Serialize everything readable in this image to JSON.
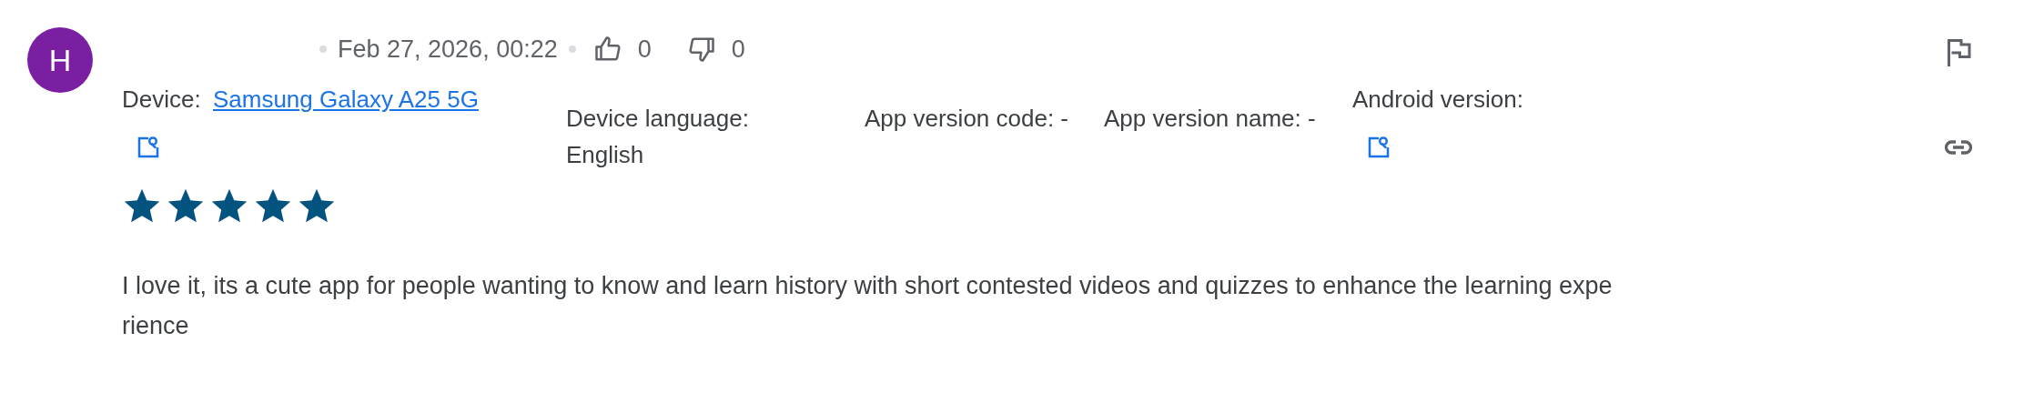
{
  "review": {
    "avatar": {
      "initial": "H",
      "color": "#7b1fa2"
    },
    "date": "Feb 27, 2026, 00:22",
    "likes": "0",
    "dislikes": "0",
    "details": [
      {
        "kind": "link",
        "label": "Device:",
        "value": "Samsung Galaxy A25 5G"
      },
      {
        "kind": "text",
        "label": "Device language:",
        "value": "English"
      },
      {
        "kind": "text",
        "label": "App version code:",
        "value": "-"
      },
      {
        "kind": "text",
        "label": "App version name:",
        "value": "-"
      },
      {
        "kind": "icon",
        "label": "Android version:"
      }
    ],
    "stars": 5,
    "text": "I love it, its a cute app for people wanting to know and learn history with short contested videos and quizzes to enhance the learning experience"
  }
}
